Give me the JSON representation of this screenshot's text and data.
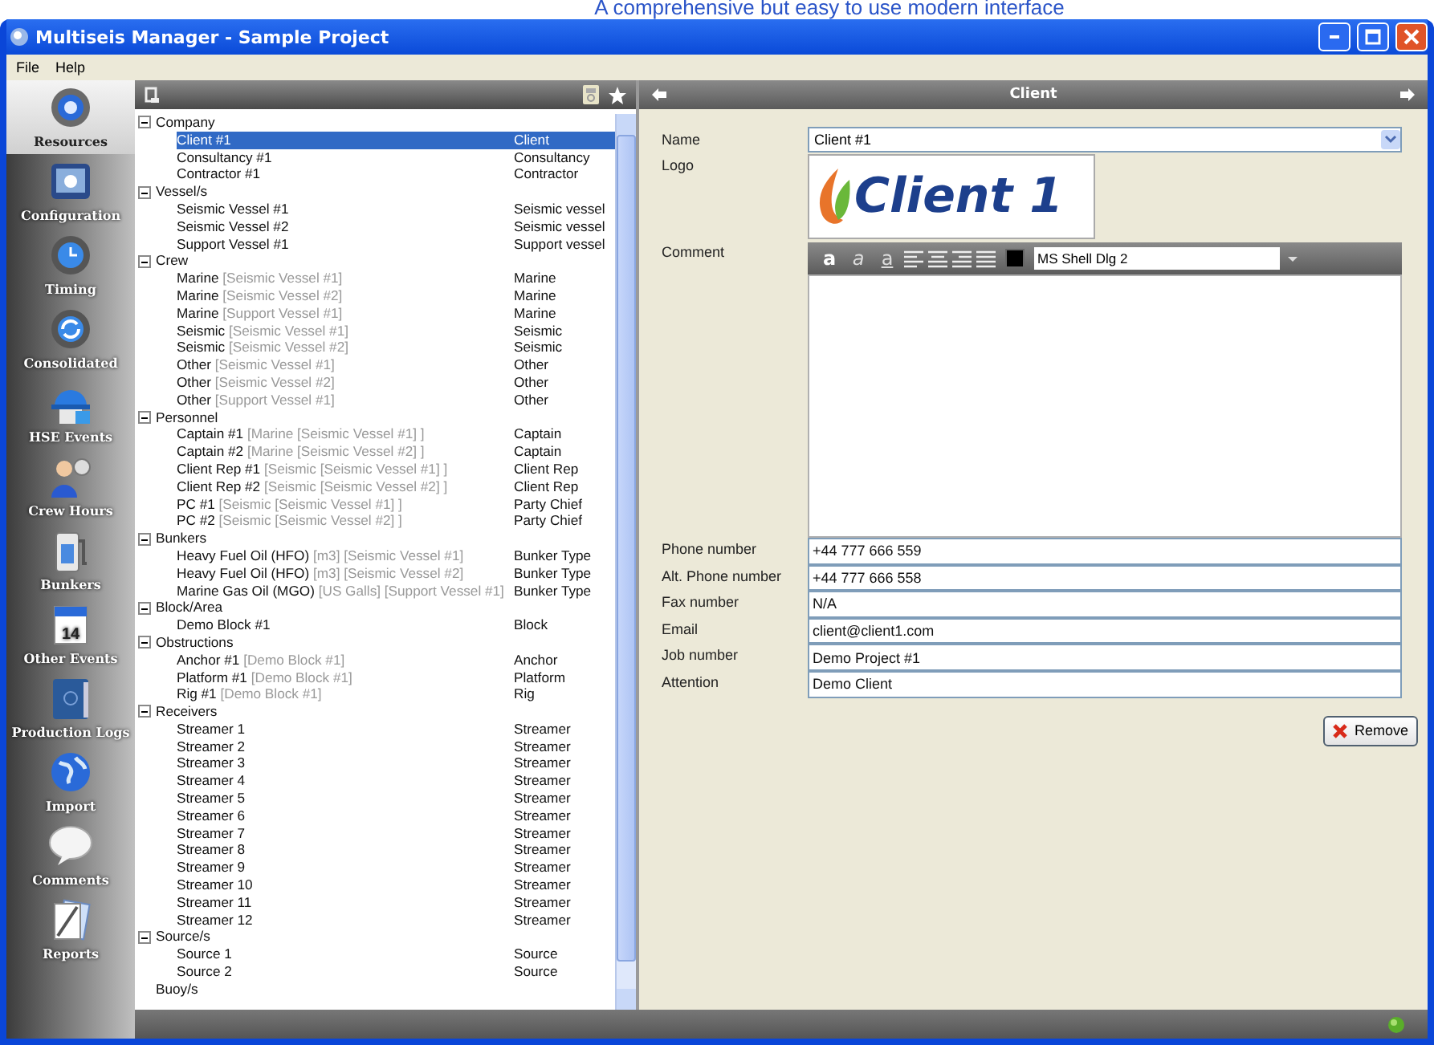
{
  "caption": "A comprehensive but easy to use modern interface",
  "window": {
    "title": "Multiseis Manager - Sample Project"
  },
  "menu": [
    "File",
    "Help"
  ],
  "sidebar": {
    "items": [
      {
        "label": "Resources",
        "selected": true
      },
      {
        "label": "Configuration",
        "selected": false
      },
      {
        "label": "Timing",
        "selected": false
      },
      {
        "label": "Consolidated",
        "selected": false
      },
      {
        "label": "HSE Events",
        "selected": false
      },
      {
        "label": "Crew Hours",
        "selected": false
      },
      {
        "label": "Bunkers",
        "selected": false
      },
      {
        "label": "Other Events",
        "icon_text": "14",
        "selected": false
      },
      {
        "label": "Production Logs",
        "selected": false
      },
      {
        "label": "Import",
        "selected": false
      },
      {
        "label": "Comments",
        "selected": false
      },
      {
        "label": "Reports",
        "selected": false
      }
    ]
  },
  "tree": [
    {
      "label": "Company",
      "expanded": true,
      "children": [
        {
          "label": "Client #1",
          "type": "Client",
          "selected": true
        },
        {
          "label": "Consultancy #1",
          "type": "Consultancy",
          "selected": false
        },
        {
          "label": "Contractor #1",
          "type": "Contractor",
          "selected": false
        }
      ]
    },
    {
      "label": "Vessel/s",
      "expanded": true,
      "children": [
        {
          "label": "Seismic Vessel #1",
          "type": "Seismic vessel",
          "selected": false
        },
        {
          "label": "Seismic Vessel #2",
          "type": "Seismic vessel",
          "selected": false
        },
        {
          "label": "Support Vessel #1",
          "type": "Support vessel",
          "selected": false
        }
      ]
    },
    {
      "label": "Crew",
      "expanded": true,
      "children": [
        {
          "label": "Marine",
          "detail": "[Seismic Vessel #1]",
          "type": "Marine",
          "selected": false
        },
        {
          "label": "Marine",
          "detail": "[Seismic Vessel #2]",
          "type": "Marine",
          "selected": false
        },
        {
          "label": "Marine",
          "detail": "[Support Vessel #1]",
          "type": "Marine",
          "selected": false
        },
        {
          "label": "Seismic",
          "detail": "[Seismic Vessel #1]",
          "type": "Seismic",
          "selected": false
        },
        {
          "label": "Seismic",
          "detail": "[Seismic Vessel #2]",
          "type": "Seismic",
          "selected": false
        },
        {
          "label": "Other",
          "detail": "[Seismic Vessel #1]",
          "type": "Other",
          "selected": false
        },
        {
          "label": "Other",
          "detail": "[Seismic Vessel #2]",
          "type": "Other",
          "selected": false
        },
        {
          "label": "Other",
          "detail": "[Support Vessel #1]",
          "type": "Other",
          "selected": false
        }
      ]
    },
    {
      "label": "Personnel",
      "expanded": true,
      "children": [
        {
          "label": "Captain #1",
          "detail": "[Marine [Seismic Vessel #1] ]",
          "type": "Captain",
          "selected": false
        },
        {
          "label": "Captain #2",
          "detail": "[Marine [Seismic Vessel #2] ]",
          "type": "Captain",
          "selected": false
        },
        {
          "label": "Client Rep #1",
          "detail": "[Seismic [Seismic Vessel #1] ]",
          "type": "Client Rep",
          "selected": false
        },
        {
          "label": "Client Rep #2",
          "detail": "[Seismic [Seismic Vessel #2] ]",
          "type": "Client Rep",
          "selected": false
        },
        {
          "label": "PC #1",
          "detail": "[Seismic [Seismic Vessel #1] ]",
          "type": "Party Chief",
          "selected": false
        },
        {
          "label": "PC #2",
          "detail": "[Seismic [Seismic Vessel #2] ]",
          "type": "Party Chief",
          "selected": false
        }
      ]
    },
    {
      "label": "Bunkers",
      "expanded": true,
      "children": [
        {
          "label": "Heavy Fuel Oil (HFO)",
          "detail": "[m3] [Seismic Vessel #1]",
          "type": "Bunker Type",
          "selected": false
        },
        {
          "label": "Heavy Fuel Oil (HFO)",
          "detail": "[m3] [Seismic Vessel #2]",
          "type": "Bunker Type",
          "selected": false
        },
        {
          "label": "Marine Gas Oil (MGO)",
          "detail": "[US Galls] [Support Vessel #1]",
          "type": "Bunker Type",
          "selected": false
        }
      ]
    },
    {
      "label": "Block/Area",
      "expanded": true,
      "children": [
        {
          "label": "Demo Block #1",
          "type": "Block",
          "selected": false
        }
      ]
    },
    {
      "label": "Obstructions",
      "expanded": true,
      "children": [
        {
          "label": "Anchor #1",
          "detail": "[Demo Block #1]",
          "type": "Anchor",
          "selected": false
        },
        {
          "label": "Platform #1",
          "detail": "[Demo Block #1]",
          "type": "Platform",
          "selected": false
        },
        {
          "label": "Rig #1",
          "detail": "[Demo Block #1]",
          "type": "Rig",
          "selected": false
        }
      ]
    },
    {
      "label": "Receivers",
      "expanded": true,
      "children": [
        {
          "label": "Streamer 1",
          "type": "Streamer",
          "selected": false
        },
        {
          "label": "Streamer 2",
          "type": "Streamer",
          "selected": false
        },
        {
          "label": "Streamer 3",
          "type": "Streamer",
          "selected": false
        },
        {
          "label": "Streamer 4",
          "type": "Streamer",
          "selected": false
        },
        {
          "label": "Streamer 5",
          "type": "Streamer",
          "selected": false
        },
        {
          "label": "Streamer 6",
          "type": "Streamer",
          "selected": false
        },
        {
          "label": "Streamer 7",
          "type": "Streamer",
          "selected": false
        },
        {
          "label": "Streamer 8",
          "type": "Streamer",
          "selected": false
        },
        {
          "label": "Streamer 9",
          "type": "Streamer",
          "selected": false
        },
        {
          "label": "Streamer 10",
          "type": "Streamer",
          "selected": false
        },
        {
          "label": "Streamer 11",
          "type": "Streamer",
          "selected": false
        },
        {
          "label": "Streamer 12",
          "type": "Streamer",
          "selected": false
        }
      ]
    },
    {
      "label": "Source/s",
      "expanded": true,
      "children": [
        {
          "label": "Source 1",
          "type": "Source",
          "selected": false
        },
        {
          "label": "Source 2",
          "type": "Source",
          "selected": false
        }
      ]
    },
    {
      "label": "Buoy/s"
    }
  ],
  "detail_panel": {
    "title": "Client",
    "name": {
      "label": "Name",
      "value": "Client #1"
    },
    "logo": {
      "label": "Logo",
      "text": "Client 1"
    },
    "comment": {
      "label": "Comment",
      "tools": [
        {
          "kind": "bold",
          "label": "a"
        },
        {
          "kind": "italic",
          "label": "a"
        },
        {
          "kind": "underline",
          "label": "a"
        },
        {
          "kind": "align-left"
        },
        {
          "kind": "align-center"
        },
        {
          "kind": "align-right"
        },
        {
          "kind": "justify"
        },
        {
          "kind": "color",
          "color": "#000000"
        }
      ],
      "font": "MS Shell Dlg 2"
    },
    "fields": [
      {
        "label": "Phone number",
        "value": "+44 777 666 559"
      },
      {
        "label": "Alt. Phone number",
        "value": "+44 777 666 558"
      },
      {
        "label": "Fax number",
        "value": "N/A"
      },
      {
        "label": "Email",
        "value": "client@client1.com"
      },
      {
        "label": "Job number",
        "value": "Demo Project #1"
      },
      {
        "label": "Attention",
        "value": "Demo Client"
      }
    ],
    "remove_button": "Remove"
  }
}
